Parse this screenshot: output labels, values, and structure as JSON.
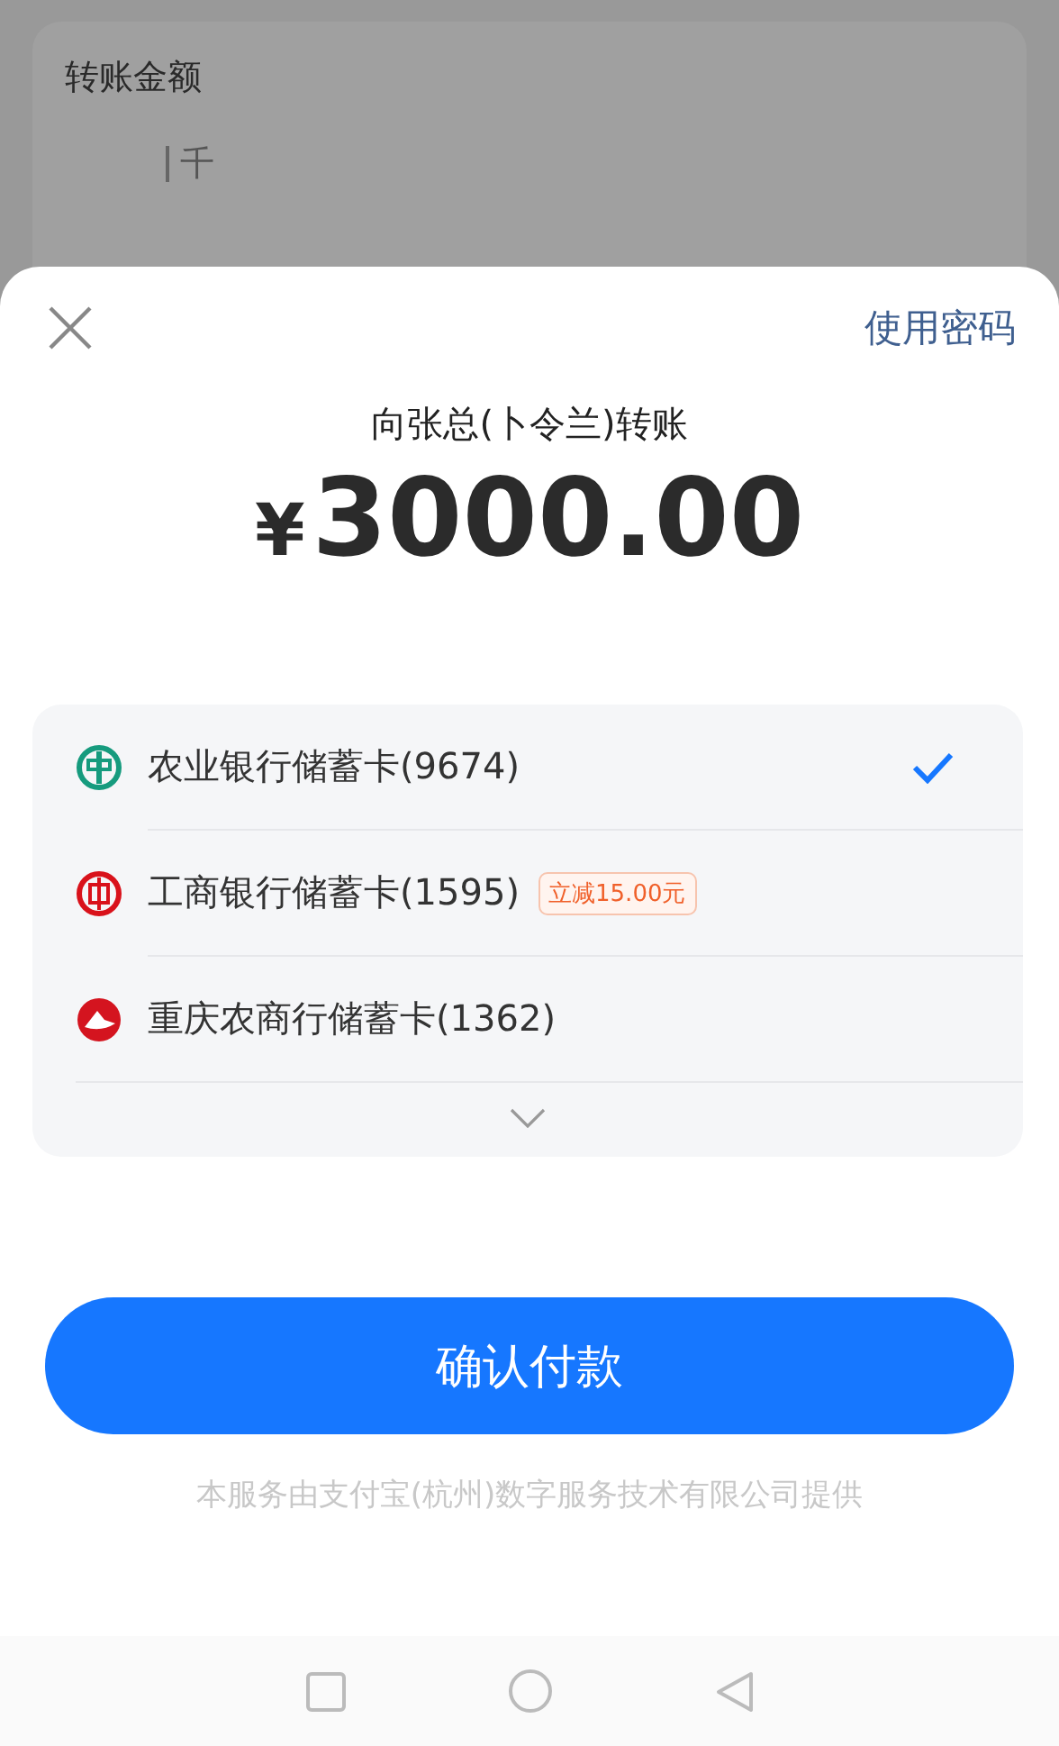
{
  "background": {
    "label": "转账金额",
    "unit_hint": "千"
  },
  "sheet": {
    "alt_action": "使用密码",
    "title": "向张总(卜令兰)转账",
    "currency": "¥",
    "amount": "3000.00",
    "methods": [
      {
        "kind": "abc",
        "name": "农业银行储蓄卡(9674)",
        "selected": true
      },
      {
        "kind": "icbc",
        "name": "工商银行储蓄卡(1595)",
        "selected": false,
        "promo": "立减15.00元"
      },
      {
        "kind": "cqrcb",
        "name": "重庆农商行储蓄卡(1362)",
        "selected": false
      }
    ],
    "confirm": "确认付款",
    "footer": "本服务由支付宝(杭州)数字服务技术有限公司提供"
  }
}
